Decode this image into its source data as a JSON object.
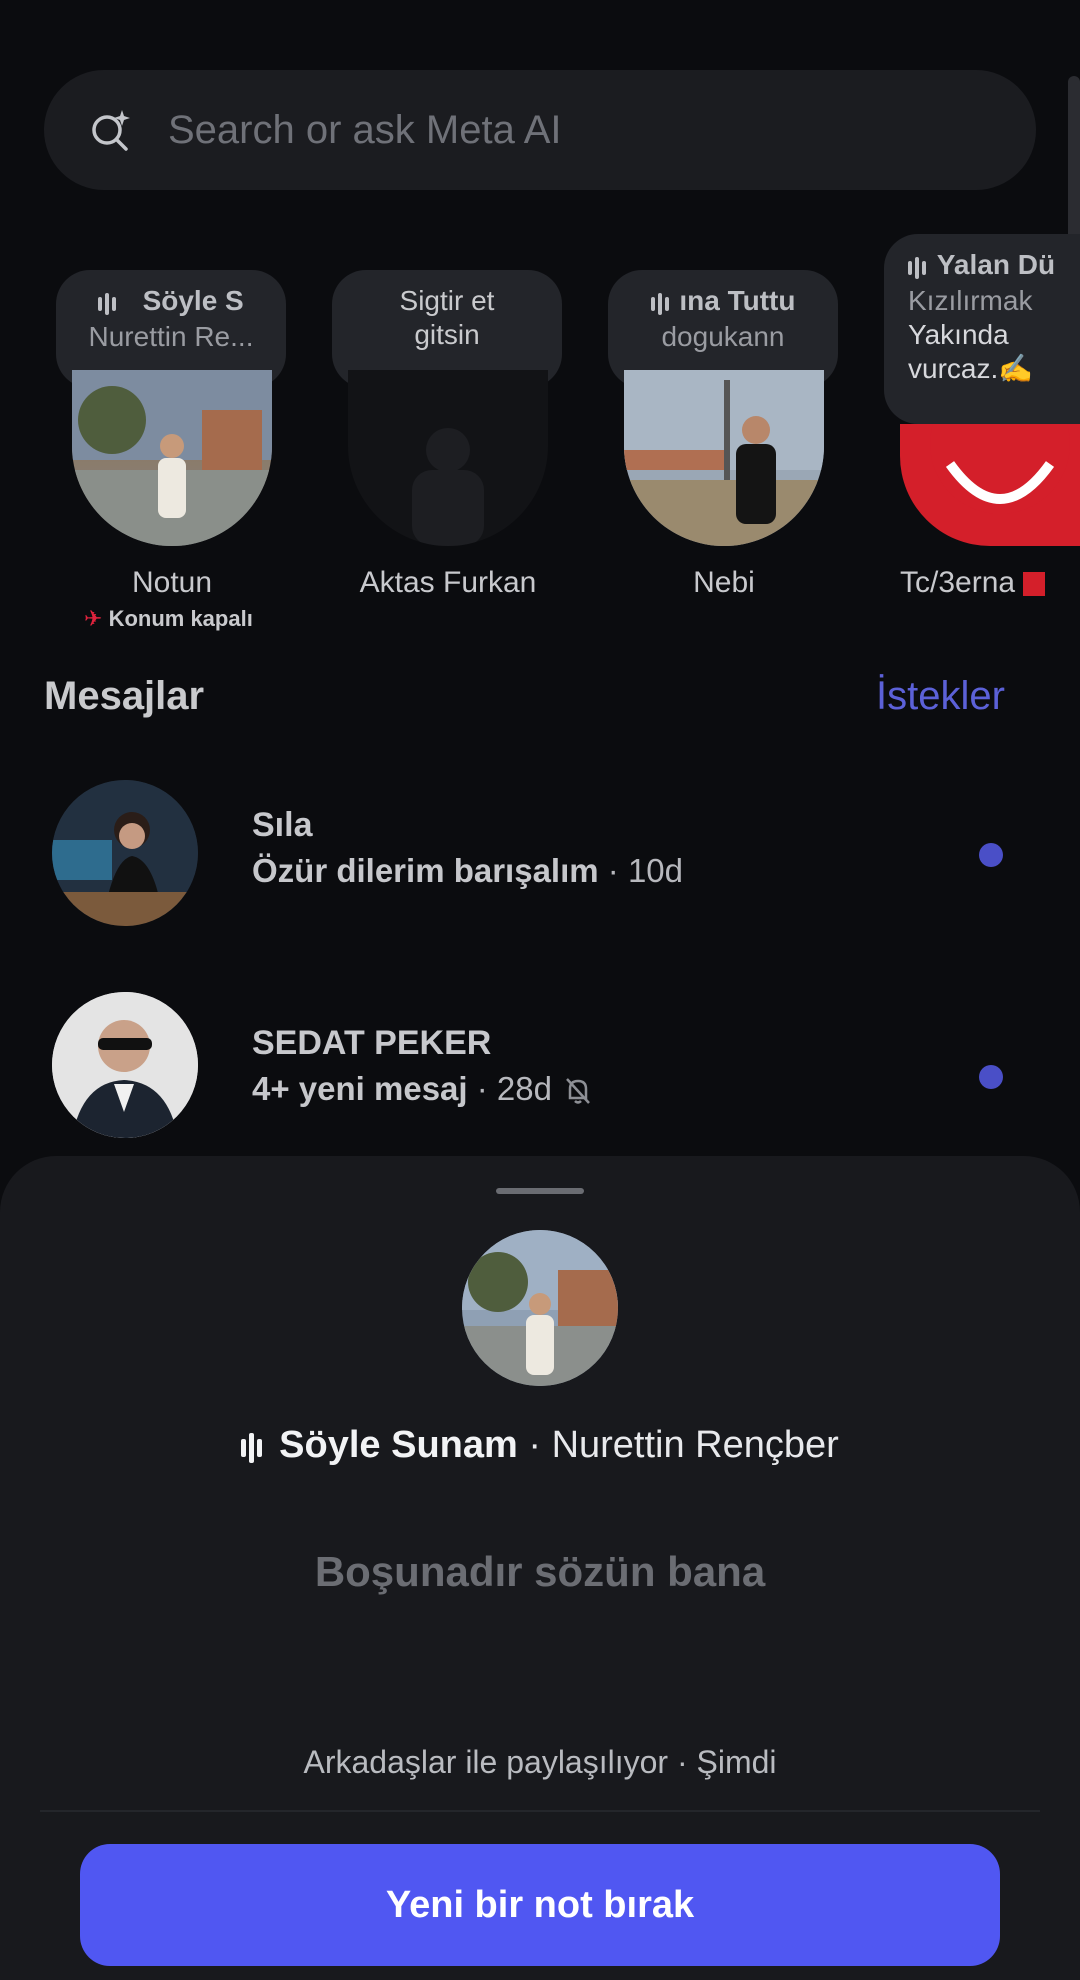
{
  "search": {
    "placeholder": "Search or ask Meta AI"
  },
  "notes": [
    {
      "song_title": "Söyle S",
      "song_artist": "Nurettin Re...",
      "name": "Notun",
      "status": "Konum kapalı"
    },
    {
      "note": "Sigtir et gitsin",
      "name": "Aktas Furkan"
    },
    {
      "song_title": "ına Tuttu",
      "song_artist": "dogukann",
      "name": "Nebi"
    },
    {
      "song_title": "Yalan Dü",
      "song_artist": "Kızılırmak",
      "note": "Yakında vurcaz.✍️",
      "name": "Tc/3erna"
    }
  ],
  "messages": {
    "title": "Mesajlar",
    "requests_label": "İstekler",
    "threads": [
      {
        "name": "Sıla",
        "preview": "Özür dilerim barışalım",
        "time": "· 10d",
        "unread": true
      },
      {
        "name": "SEDAT PEKER",
        "preview": "4+ yeni mesaj",
        "time": "· 28d",
        "muted": true,
        "unread": true
      }
    ]
  },
  "sheet": {
    "song_title": "Söyle Sunam",
    "song_artist": "· Nurettin Rençber",
    "note_text": "Boşunadır sözün bana",
    "shared_info": "Arkadaşlar ile paylaşılıyor · Şimdi",
    "cta_label": "Yeni bir not bırak"
  },
  "colors": {
    "accent": "#5057f2",
    "unread_dot": "#4a4fc7",
    "requests": "#5c61d8"
  }
}
